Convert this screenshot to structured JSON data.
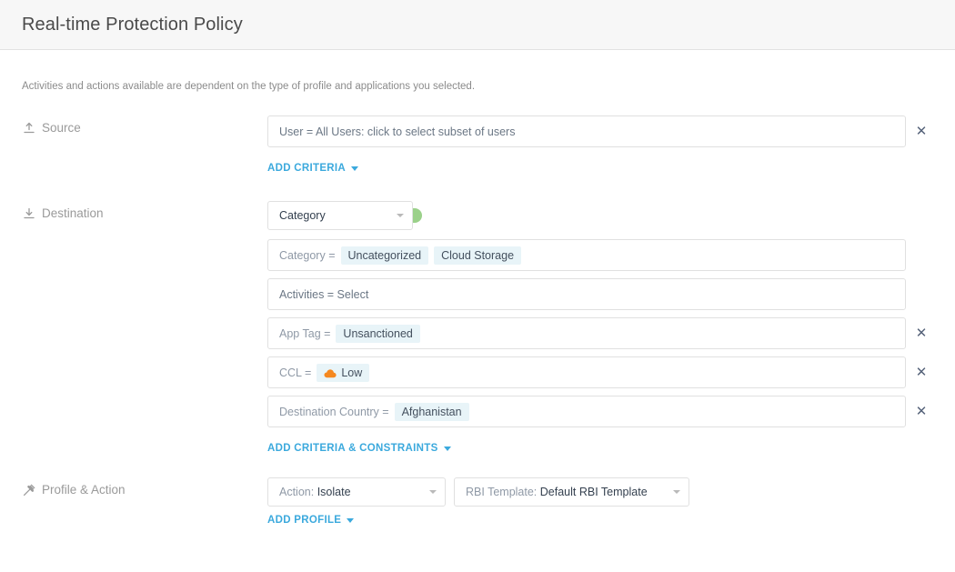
{
  "header": {
    "title": "Real-time Protection Policy"
  },
  "help_text": "Activities and actions available are dependent on the type of profile and applications you selected.",
  "sections": {
    "source": {
      "label": "Source",
      "icon": "upload-icon",
      "criteria": [
        {
          "text": "User = All Users: click to select subset of users",
          "removable": false
        }
      ],
      "add_link": "ADD CRITERIA"
    },
    "destination": {
      "label": "Destination",
      "icon": "download-icon",
      "category_select": {
        "value": "Category",
        "toggle_color": "#9bd18a"
      },
      "criteria": [
        {
          "key": "Category =",
          "chips": [
            "Uncategorized",
            "Cloud Storage"
          ],
          "removable": false
        },
        {
          "plain": "Activities = Select",
          "chips": [],
          "removable": false
        },
        {
          "key": "App Tag =",
          "chips": [
            "Unsanctioned"
          ],
          "removable": true
        },
        {
          "key": "CCL =",
          "chips": [
            "Low"
          ],
          "chip_icon": "cloud-icon",
          "chip_icon_color": "#f5881f",
          "removable": true
        },
        {
          "key": "Destination Country =",
          "chips": [
            "Afghanistan"
          ],
          "removable": true
        }
      ],
      "add_link": "ADD CRITERIA & CONSTRAINTS"
    },
    "profile_action": {
      "label": "Profile & Action",
      "icon": "gavel-icon",
      "action_select": {
        "label": "Action:",
        "value": "Isolate"
      },
      "rbi_select": {
        "label": "RBI Template:",
        "value": "Default RBI Template"
      },
      "add_link": "ADD PROFILE"
    }
  },
  "icons": {
    "close": "✕"
  },
  "colors": {
    "link": "#3ba9dd",
    "chip_bg": "#e8f4f8",
    "toggle_green": "#9bd18a",
    "ccl_orange": "#f5881f"
  }
}
